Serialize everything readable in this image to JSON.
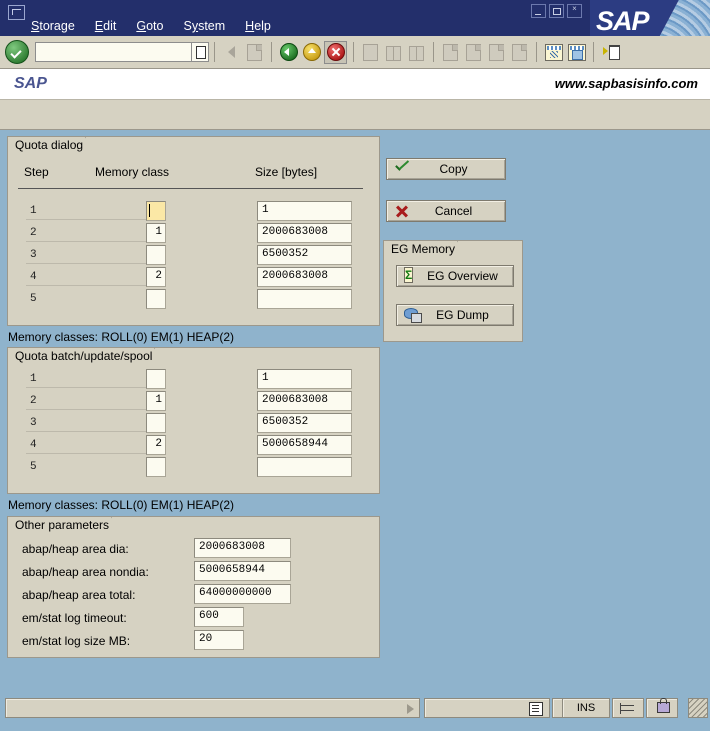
{
  "window": {
    "menu": [
      {
        "label": "Storage",
        "accel": "S"
      },
      {
        "label": "Edit",
        "accel": "E"
      },
      {
        "label": "Goto",
        "accel": "G"
      },
      {
        "label": "System",
        "accel": "y"
      },
      {
        "label": "Help",
        "accel": "H"
      }
    ],
    "logo_text": "SAP",
    "minimize": "minimize",
    "maximize": "maximize",
    "close": "close"
  },
  "toolbar": {
    "command_value": "",
    "command_placeholder": ""
  },
  "header": {
    "left_title": "SAP",
    "right_title": "www.sapbasisinfo.com"
  },
  "quota_dialog": {
    "title": "Quota dialog",
    "columns": [
      "Step",
      "Memory class",
      "Size [bytes]"
    ],
    "rows": [
      {
        "step": "1",
        "memory_class": "",
        "size": "1"
      },
      {
        "step": "2",
        "memory_class": "1",
        "size": "2000683008"
      },
      {
        "step": "3",
        "memory_class": "",
        "size": "6500352"
      },
      {
        "step": "4",
        "memory_class": "2",
        "size": "2000683008"
      },
      {
        "step": "5",
        "memory_class": "",
        "size": ""
      }
    ],
    "memory_classes_note": "Memory classes: ROLL(0) EM(1) HEAP(2)"
  },
  "quota_batch": {
    "title": "Quota batch/update/spool",
    "rows": [
      {
        "step": "1",
        "memory_class": "",
        "size": "1"
      },
      {
        "step": "2",
        "memory_class": "1",
        "size": "2000683008"
      },
      {
        "step": "3",
        "memory_class": "",
        "size": "6500352"
      },
      {
        "step": "4",
        "memory_class": "2",
        "size": "5000658944"
      },
      {
        "step": "5",
        "memory_class": "",
        "size": ""
      }
    ],
    "memory_classes_note": "Memory classes: ROLL(0) EM(1) HEAP(2)"
  },
  "other_parameters": {
    "title": "Other parameters",
    "rows": [
      {
        "label": "abap/heap area dia:",
        "value": "2000683008"
      },
      {
        "label": "abap/heap area nondia:",
        "value": "5000658944"
      },
      {
        "label": "abap/heap area total:",
        "value": "64000000000"
      },
      {
        "label": "em/stat log timeout:",
        "value": "600"
      },
      {
        "label": "em/stat log size MB:",
        "value": "20"
      }
    ]
  },
  "actions": {
    "copy": "Copy",
    "cancel": "Cancel"
  },
  "eg_memory": {
    "title": "EG Memory",
    "overview": "EG Overview",
    "dump": "EG Dump"
  },
  "statusbar": {
    "message": "",
    "system_field": "",
    "blank_field": "",
    "insert_mode": "INS"
  },
  "colors": {
    "titlebar": "#232F6B",
    "toolbar": "#D6D2C2",
    "canvas": "#8FB3CC",
    "field": "#FCFBF0",
    "field_focus": "#FBE8A6"
  }
}
